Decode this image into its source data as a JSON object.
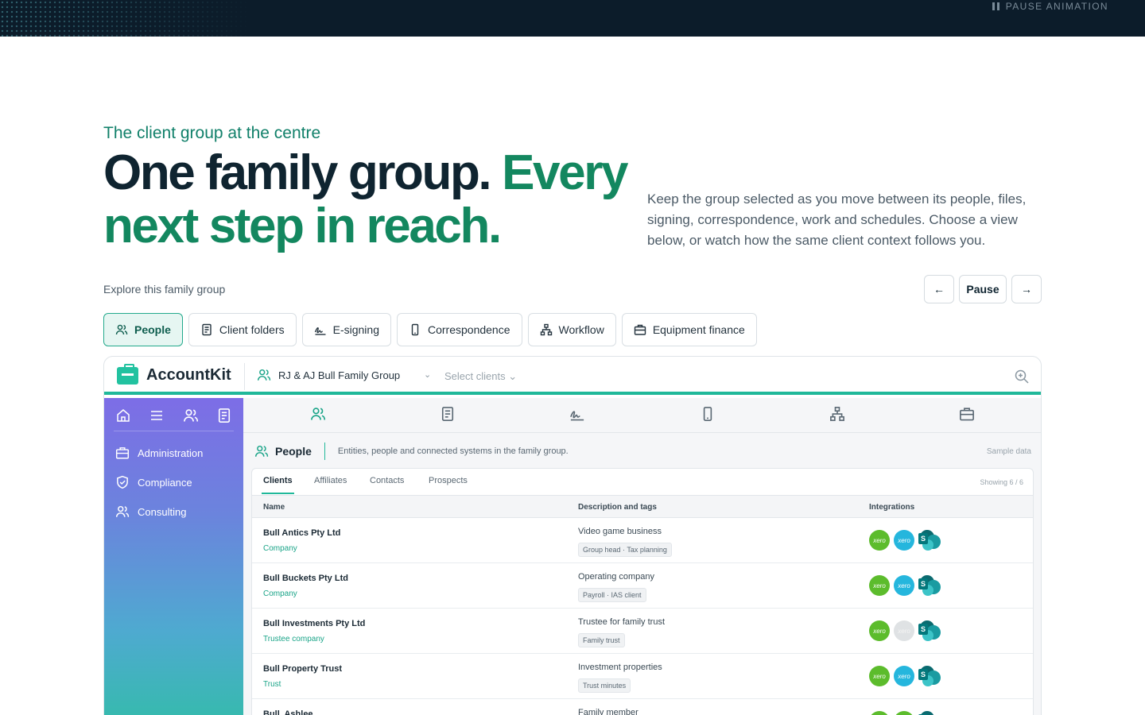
{
  "top": {
    "pause_animation": "PAUSE ANIMATION"
  },
  "hero": {
    "eyebrow": "The client group at the centre",
    "headline_dark": "One family group.",
    "headline_green": "Every next step in reach.",
    "intro": "Keep the group selected as you move between its people, files, signing, correspondence, work and schedules. Choose a view below, or watch how the same client context follows you."
  },
  "explore": {
    "label": "Explore this family group",
    "prev": "←",
    "pause": "Pause",
    "next": "→"
  },
  "tabs": [
    {
      "label": "People",
      "icon": "people-icon",
      "active": true
    },
    {
      "label": "Client folders",
      "icon": "document-icon"
    },
    {
      "label": "E-signing",
      "icon": "signature-icon"
    },
    {
      "label": "Correspondence",
      "icon": "phone-icon"
    },
    {
      "label": "Workflow",
      "icon": "workflow-icon"
    },
    {
      "label": "Equipment finance",
      "icon": "briefcase-icon"
    }
  ],
  "app": {
    "brand": "AccountKit",
    "group": "RJ & AJ Bull Family Group",
    "group_chevron": "⌄",
    "select_clients": "Select clients ⌄",
    "sidebar": [
      {
        "label": "Administration",
        "icon": "briefcase-icon"
      },
      {
        "label": "Compliance",
        "icon": "shield-check-icon"
      },
      {
        "label": "Consulting",
        "icon": "people-icon"
      }
    ],
    "section": {
      "title": "People",
      "description": "Entities, people and connected systems in the family group.",
      "sample": "Sample data"
    },
    "table_tabs": [
      "Clients",
      "Affiliates",
      "Contacts",
      "Prospects"
    ],
    "showing": "Showing 6 / 6",
    "columns": [
      "Name",
      "Description and tags",
      "Integrations"
    ],
    "rows": [
      {
        "name": "Bull Antics Pty Ltd",
        "type": "Company",
        "desc": "Video game business",
        "tags": "Group head · Tax planning",
        "xero2": "blue"
      },
      {
        "name": "Bull Buckets Pty Ltd",
        "type": "Company",
        "desc": "Operating company",
        "tags": "Payroll · IAS client",
        "xero2": "blue"
      },
      {
        "name": "Bull Investments Pty Ltd",
        "type": "Trustee company",
        "desc": "Trustee for family trust",
        "tags": "Family trust",
        "xero2": "grey"
      },
      {
        "name": "Bull Property Trust",
        "type": "Trust",
        "desc": "Investment properties",
        "tags": "Trust minutes",
        "xero2": "blue"
      },
      {
        "name": "Bull, Ashlee",
        "type": "",
        "desc": "Family member",
        "tags": "",
        "xero2": "green"
      }
    ],
    "integration_labels": {
      "xero": "xero",
      "sharepoint": "S"
    }
  },
  "colors": {
    "accent": "#20b89a",
    "green_text": "#13875f",
    "dark_band": "#0c1c2a",
    "xero_green": "#5cbc2c",
    "xero_blue": "#25b6dd"
  }
}
